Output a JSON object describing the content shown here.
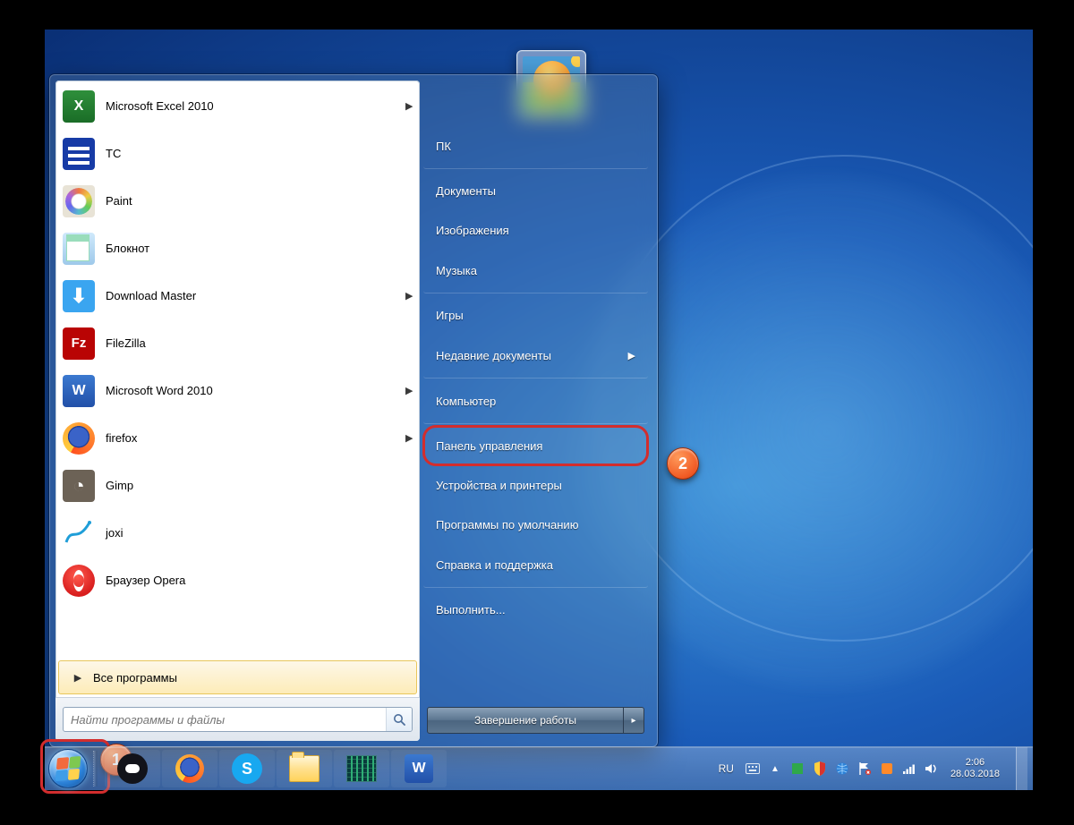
{
  "desktop": {},
  "start_menu": {
    "programs": [
      {
        "label": "Microsoft Excel 2010",
        "icon": "excel-icon",
        "has_submenu": true
      },
      {
        "label": "TC",
        "icon": "tc-icon",
        "has_submenu": false
      },
      {
        "label": "Paint",
        "icon": "paint-icon",
        "has_submenu": false
      },
      {
        "label": "Блокнот",
        "icon": "notepad-icon",
        "has_submenu": false
      },
      {
        "label": "Download Master",
        "icon": "downloadmaster-icon",
        "has_submenu": true
      },
      {
        "label": "FileZilla",
        "icon": "filezilla-icon",
        "has_submenu": false
      },
      {
        "label": "Microsoft Word 2010",
        "icon": "word-icon",
        "has_submenu": true
      },
      {
        "label": "firefox",
        "icon": "firefox-icon",
        "has_submenu": true
      },
      {
        "label": "Gimp",
        "icon": "gimp-icon",
        "has_submenu": false
      },
      {
        "label": "joxi",
        "icon": "joxi-icon",
        "has_submenu": false
      },
      {
        "label": "Браузер Opera",
        "icon": "opera-icon",
        "has_submenu": false
      }
    ],
    "all_programs_label": "Все программы",
    "search_placeholder": "Найти программы и файлы",
    "right_items": [
      {
        "label": "ПК",
        "sep_after": true,
        "has_submenu": false
      },
      {
        "label": "Документы",
        "sep_after": false,
        "has_submenu": false
      },
      {
        "label": "Изображения",
        "sep_after": false,
        "has_submenu": false
      },
      {
        "label": "Музыка",
        "sep_after": true,
        "has_submenu": false
      },
      {
        "label": "Игры",
        "sep_after": false,
        "has_submenu": false
      },
      {
        "label": "Недавние документы",
        "sep_after": true,
        "has_submenu": true
      },
      {
        "label": "Компьютер",
        "sep_after": true,
        "has_submenu": false
      },
      {
        "label": "Панель управления",
        "sep_after": false,
        "has_submenu": false,
        "highlight": true
      },
      {
        "label": "Устройства и принтеры",
        "sep_after": false,
        "has_submenu": false
      },
      {
        "label": "Программы по умолчанию",
        "sep_after": false,
        "has_submenu": false
      },
      {
        "label": "Справка и поддержка",
        "sep_after": true,
        "has_submenu": false
      },
      {
        "label": "Выполнить...",
        "sep_after": false,
        "has_submenu": false
      }
    ],
    "shutdown_label": "Завершение работы"
  },
  "annotations": {
    "badge1": "1",
    "badge2": "2"
  },
  "taskbar": {
    "lang": "RU",
    "time": "2:06",
    "date": "28.03.2018"
  }
}
